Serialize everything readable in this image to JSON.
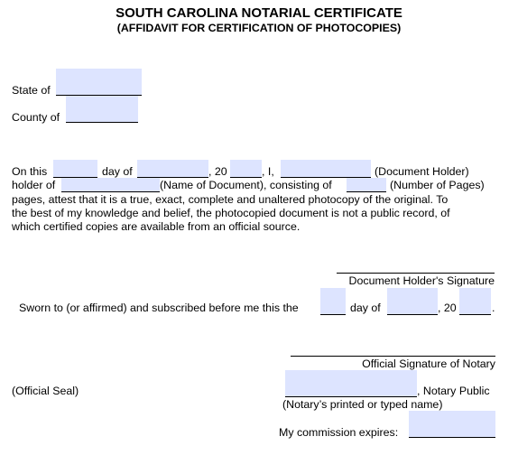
{
  "header": {
    "title": "SOUTH CAROLINA NOTARIAL CERTIFICATE",
    "subtitle": "(AFFIDAVIT FOR CERTIFICATION OF PHOTOCOPIES)"
  },
  "venue": {
    "state_label": "State of",
    "state_value": "",
    "county_label": "County of",
    "county_value": ""
  },
  "affidavit": {
    "on_this": "On this",
    "day_of": "day of",
    "comma_20": ", 20",
    "comma_i": ", I,",
    "document_holder": "(Document Holder)",
    "holder_of": "holder of",
    "name_of_document": "(Name of Document), consisting of",
    "number_of_pages": "(Number of Pages)",
    "line3": "pages, attest that it is a true, exact, complete and unaltered photocopy of the original. To",
    "line4": "the best of my knowledge and belief, the photocopied document is not a public record, of",
    "line5": "which certified copies are available from an official source.",
    "day_value": "",
    "month_value": "",
    "year_value": "",
    "holder_name_value": "",
    "document_name_value": "",
    "pages_value": ""
  },
  "holder_signature": {
    "label": "Document Holder's Signature"
  },
  "jurat": {
    "text": "Sworn to (or affirmed) and subscribed before me this the",
    "day_of": "day of",
    "comma_20": ", 20",
    "period": ".",
    "day_value": "",
    "month_value": "",
    "year_value": ""
  },
  "notary": {
    "signature_label": "Official Signature of Notary",
    "seal_label": "(Official Seal)",
    "notary_public": ", Notary Public",
    "printed_name_label": "(Notary’s printed or typed name)",
    "commission_label": "My commission expires:",
    "name_value": "",
    "commission_value": ""
  },
  "colors": {
    "field_fill": "#dde4ff"
  }
}
